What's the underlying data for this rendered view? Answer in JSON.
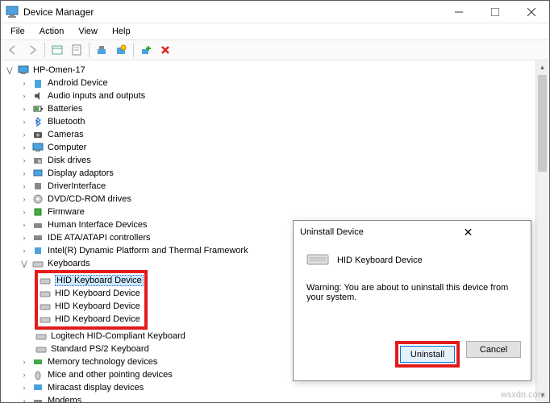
{
  "window": {
    "title": "Device Manager"
  },
  "menu": {
    "file": "File",
    "action": "Action",
    "view": "View",
    "help": "Help"
  },
  "tree": {
    "root": "HP-Omen-17",
    "items": [
      "Android Device",
      "Audio inputs and outputs",
      "Batteries",
      "Bluetooth",
      "Cameras",
      "Computer",
      "Disk drives",
      "Display adaptors",
      "DriverInterface",
      "DVD/CD-ROM drives",
      "Firmware",
      "Human Interface Devices",
      "IDE ATA/ATAPI controllers",
      "Intel(R) Dynamic Platform and Thermal Framework",
      "Keyboards"
    ],
    "keyboards": [
      "HID Keyboard Device",
      "HID Keyboard Device",
      "HID Keyboard Device",
      "HID Keyboard Device",
      "Logitech HID-Compliant Keyboard",
      "Standard PS/2 Keyboard"
    ],
    "after": [
      "Memory technology devices",
      "Mice and other pointing devices",
      "Miracast display devices",
      "Modems"
    ]
  },
  "dialog": {
    "title": "Uninstall Device",
    "device": "HID Keyboard Device",
    "warning": "Warning: You are about to uninstall this device from your system.",
    "uninstall": "Uninstall",
    "cancel": "Cancel"
  },
  "watermark": "wsxdn.com"
}
